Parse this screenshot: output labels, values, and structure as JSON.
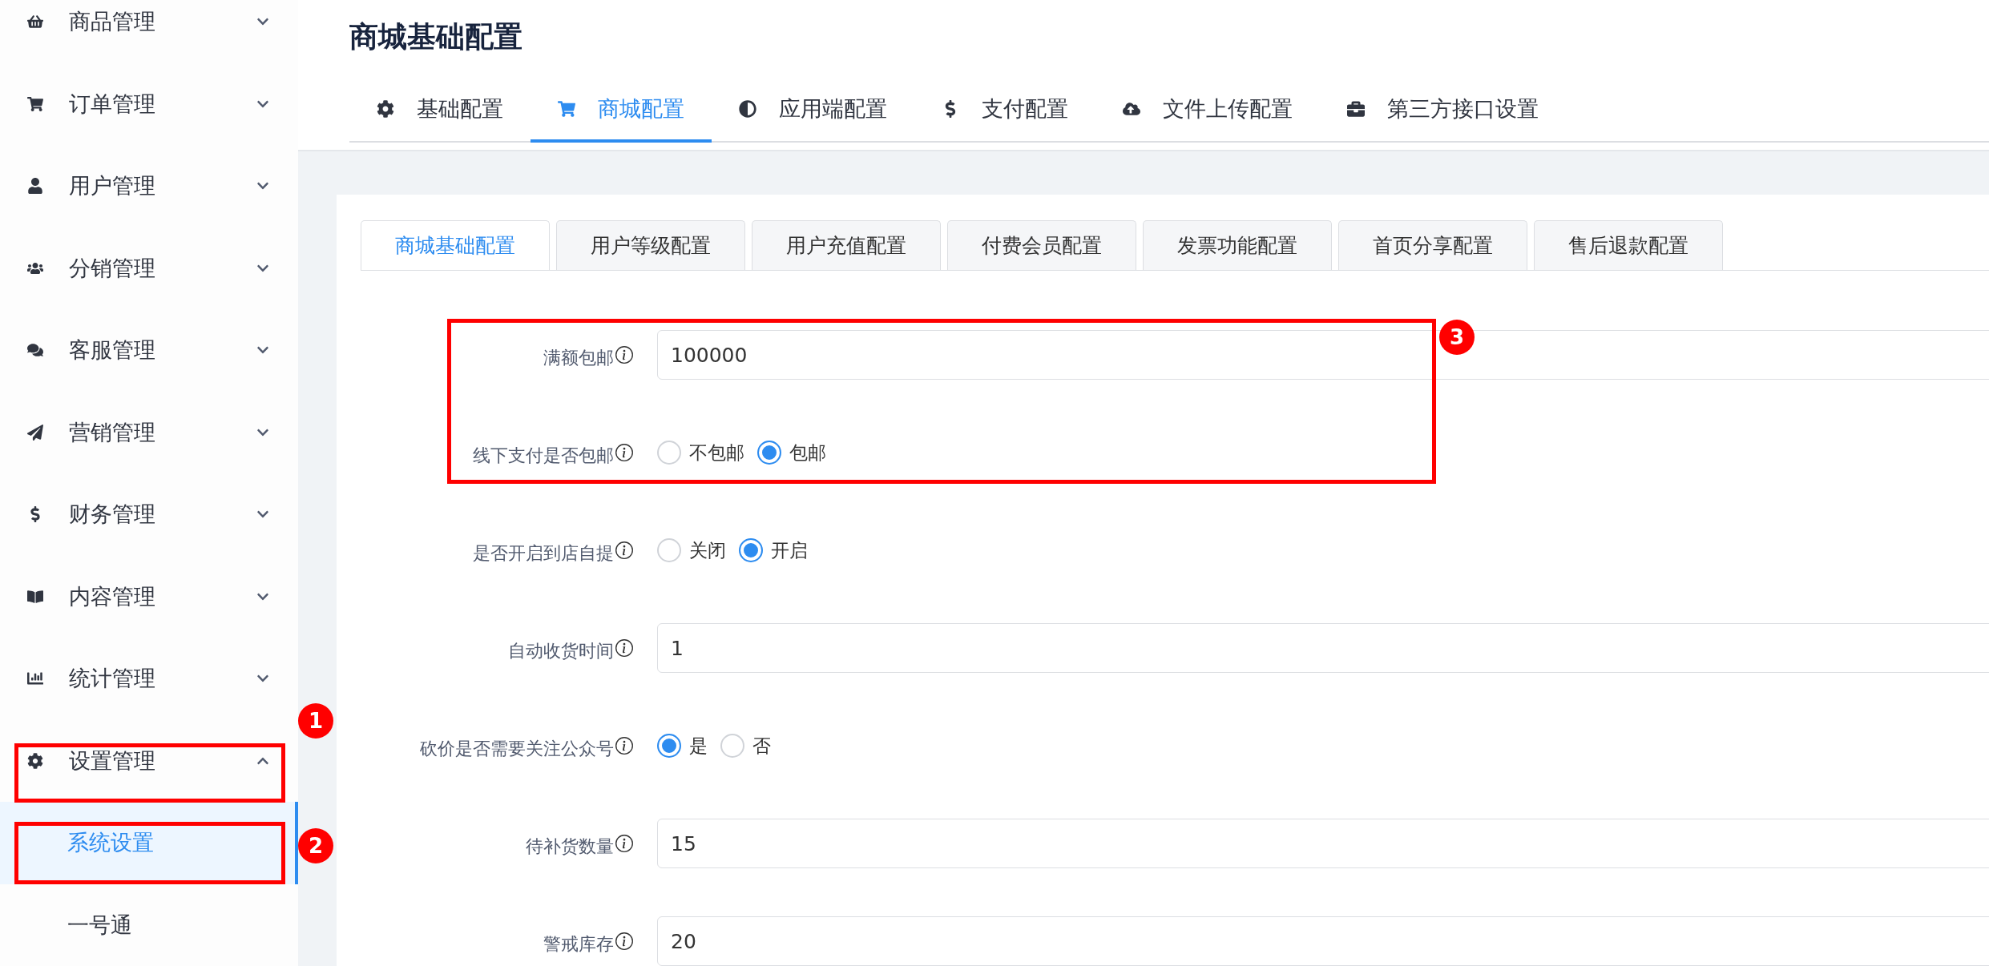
{
  "sidebar": {
    "items": [
      {
        "label": "商品管理",
        "expanded": false
      },
      {
        "label": "订单管理",
        "expanded": false
      },
      {
        "label": "用户管理",
        "expanded": false
      },
      {
        "label": "分销管理",
        "expanded": false
      },
      {
        "label": "客服管理",
        "expanded": false
      },
      {
        "label": "营销管理",
        "expanded": false
      },
      {
        "label": "财务管理",
        "expanded": false
      },
      {
        "label": "内容管理",
        "expanded": false
      },
      {
        "label": "统计管理",
        "expanded": false
      },
      {
        "label": "设置管理",
        "expanded": true,
        "children": [
          {
            "label": "系统设置",
            "selected": true
          },
          {
            "label": "一号通",
            "selected": false
          }
        ]
      }
    ]
  },
  "page_title": "商城基础配置",
  "top_tabs": [
    {
      "label": "基础配置",
      "selected": false
    },
    {
      "label": "商城配置",
      "selected": true
    },
    {
      "label": "应用端配置",
      "selected": false
    },
    {
      "label": "支付配置",
      "selected": false
    },
    {
      "label": "文件上传配置",
      "selected": false
    },
    {
      "label": "第三方接口设置",
      "selected": false
    }
  ],
  "sub_tabs": [
    {
      "label": "商城基础配置",
      "selected": true
    },
    {
      "label": "用户等级配置",
      "selected": false
    },
    {
      "label": "用户充值配置",
      "selected": false
    },
    {
      "label": "付费会员配置",
      "selected": false
    },
    {
      "label": "发票功能配置",
      "selected": false
    },
    {
      "label": "首页分享配置",
      "selected": false
    },
    {
      "label": "售后退款配置",
      "selected": false
    }
  ],
  "form": {
    "fields": [
      {
        "kind": "input",
        "label": "满额包邮",
        "value": "100000"
      },
      {
        "kind": "radio",
        "label": "线下支付是否包邮",
        "options": [
          {
            "label": "不包邮",
            "selected": false
          },
          {
            "label": "包邮",
            "selected": true
          }
        ]
      },
      {
        "kind": "radio",
        "label": "是否开启到店自提",
        "options": [
          {
            "label": "关闭",
            "selected": false
          },
          {
            "label": "开启",
            "selected": true
          }
        ]
      },
      {
        "kind": "input",
        "label": "自动收货时间",
        "value": "1"
      },
      {
        "kind": "radio",
        "label": "砍价是否需要关注公众号",
        "options": [
          {
            "label": "是",
            "selected": true
          },
          {
            "label": "否",
            "selected": false
          }
        ]
      },
      {
        "kind": "input",
        "label": "待补货数量",
        "value": "15"
      },
      {
        "kind": "input",
        "label": "警戒库存",
        "value": "20"
      }
    ]
  },
  "annotations": [
    {
      "label": "1"
    },
    {
      "label": "2"
    },
    {
      "label": "3"
    }
  ]
}
